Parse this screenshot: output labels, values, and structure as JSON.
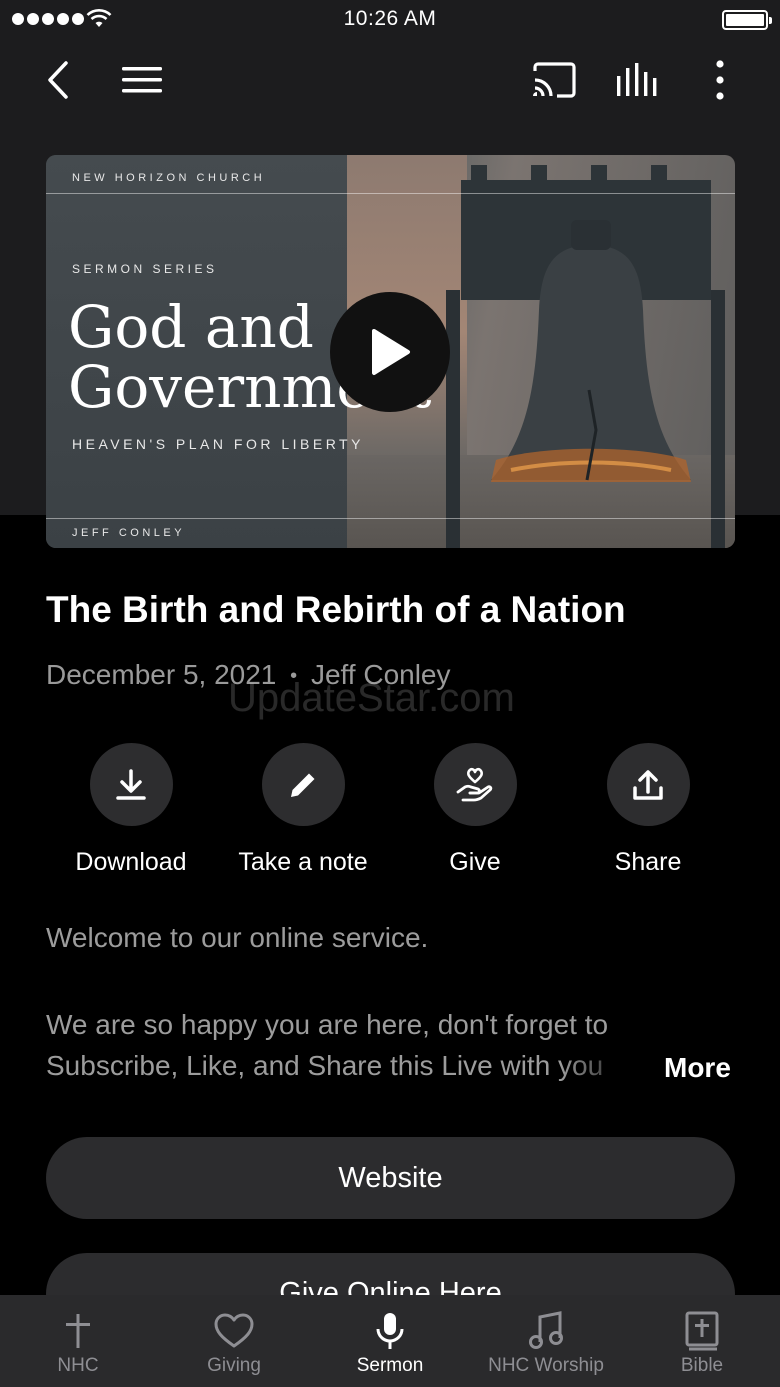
{
  "status_bar": {
    "time": "10:26 AM"
  },
  "nav": {
    "icons": [
      "back-chevron-icon",
      "menu-icon",
      "cast-icon",
      "audio-bars-icon",
      "more-vertical-icon"
    ]
  },
  "hero": {
    "church": "NEW HORIZON CHURCH",
    "series_label": "SERMON SERIES",
    "series_title_line1": "God and",
    "series_title_line2": "Government",
    "subtitle": "HEAVEN'S PLAN FOR LIBERTY",
    "speaker": "JEFF CONLEY"
  },
  "sermon": {
    "title": "The Birth and Rebirth of a Nation",
    "date": "December 5, 2021",
    "separator": "•",
    "speaker": "Jeff Conley"
  },
  "watermark": "UpdateStar.com",
  "actions": [
    {
      "label": "Download",
      "icon": "download-icon"
    },
    {
      "label": "Take a note",
      "icon": "pencil-icon"
    },
    {
      "label": "Give",
      "icon": "hand-heart-icon"
    },
    {
      "label": "Share",
      "icon": "share-icon"
    }
  ],
  "description": {
    "line1": "Welcome to our online service.",
    "line2": "We are so happy you are here, don't forget to",
    "line3": "Subscribe, Like, and Share this Live with you",
    "more": "More"
  },
  "buttons": {
    "website": "Website",
    "give_online": "Give Online Here"
  },
  "tabs": [
    {
      "label": "NHC",
      "icon": "cross-icon",
      "active": false
    },
    {
      "label": "Giving",
      "icon": "heart-icon",
      "active": false
    },
    {
      "label": "Sermon",
      "icon": "microphone-icon",
      "active": true
    },
    {
      "label": "NHC Worship",
      "icon": "music-note-icon",
      "active": false
    },
    {
      "label": "Bible",
      "icon": "bible-icon",
      "active": false
    }
  ],
  "colors": {
    "background": "#000000",
    "surface": "#2c2c2e",
    "secondary_text": "#9a9a9a",
    "tab_inactive": "#8e8e93"
  }
}
